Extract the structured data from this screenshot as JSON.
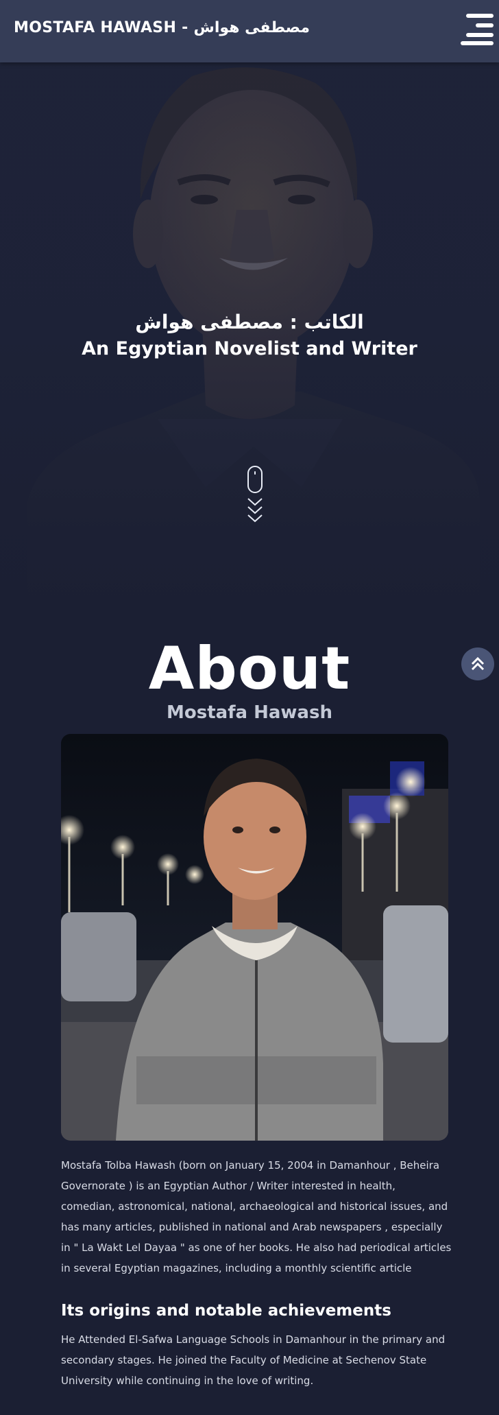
{
  "header": {
    "brand": "MOSTAFA HAWASH - مصطفى هواش",
    "menu_icon": "hamburger-menu-icon"
  },
  "hero": {
    "line1": "الكاتب : مصطفى هواش",
    "line2": "An Egyptian Novelist and Writer",
    "scroll_icon": "mouse-scroll-icon",
    "chevrons_icon": "triple-chevron-down-icon"
  },
  "about": {
    "title": "About",
    "subtitle": "Mostafa Hawash",
    "back_to_top_icon": "double-chevron-up-icon",
    "paragraph": "Mostafa Tolba Hawash (born on January 15, 2004 in Damanhour , Beheira Governorate ) is an Egyptian Author / Writer interested in health, comedian, astronomical, national, archaeological and historical issues, and has many articles, published in national and Arab newspapers , especially in \" La Wakt Lel Dayaa \" as one of her books. He also had periodical articles in several Egyptian magazines, including a monthly scientific article",
    "section_title": "Its origins and notable achievements",
    "section_text": "He Attended El-Safwa Language Schools in Damanhour in the primary and secondary stages. He joined the Faculty of Medicine at Sechenov State University while continuing in the love of writing."
  },
  "colors": {
    "header_bg": "#353d57",
    "page_bg": "#1b1f33",
    "back_to_top_bg": "#4a5576"
  }
}
